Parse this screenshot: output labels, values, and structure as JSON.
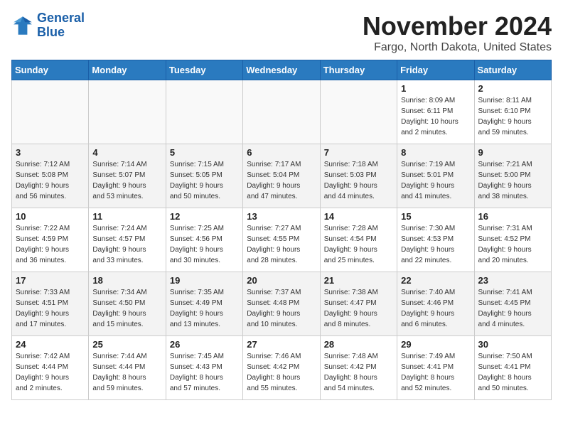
{
  "header": {
    "logo_line1": "General",
    "logo_line2": "Blue",
    "month_title": "November 2024",
    "location": "Fargo, North Dakota, United States"
  },
  "weekdays": [
    "Sunday",
    "Monday",
    "Tuesday",
    "Wednesday",
    "Thursday",
    "Friday",
    "Saturday"
  ],
  "weeks": [
    [
      {
        "day": "",
        "info": ""
      },
      {
        "day": "",
        "info": ""
      },
      {
        "day": "",
        "info": ""
      },
      {
        "day": "",
        "info": ""
      },
      {
        "day": "",
        "info": ""
      },
      {
        "day": "1",
        "info": "Sunrise: 8:09 AM\nSunset: 6:11 PM\nDaylight: 10 hours\nand 2 minutes."
      },
      {
        "day": "2",
        "info": "Sunrise: 8:11 AM\nSunset: 6:10 PM\nDaylight: 9 hours\nand 59 minutes."
      }
    ],
    [
      {
        "day": "3",
        "info": "Sunrise: 7:12 AM\nSunset: 5:08 PM\nDaylight: 9 hours\nand 56 minutes."
      },
      {
        "day": "4",
        "info": "Sunrise: 7:14 AM\nSunset: 5:07 PM\nDaylight: 9 hours\nand 53 minutes."
      },
      {
        "day": "5",
        "info": "Sunrise: 7:15 AM\nSunset: 5:05 PM\nDaylight: 9 hours\nand 50 minutes."
      },
      {
        "day": "6",
        "info": "Sunrise: 7:17 AM\nSunset: 5:04 PM\nDaylight: 9 hours\nand 47 minutes."
      },
      {
        "day": "7",
        "info": "Sunrise: 7:18 AM\nSunset: 5:03 PM\nDaylight: 9 hours\nand 44 minutes."
      },
      {
        "day": "8",
        "info": "Sunrise: 7:19 AM\nSunset: 5:01 PM\nDaylight: 9 hours\nand 41 minutes."
      },
      {
        "day": "9",
        "info": "Sunrise: 7:21 AM\nSunset: 5:00 PM\nDaylight: 9 hours\nand 38 minutes."
      }
    ],
    [
      {
        "day": "10",
        "info": "Sunrise: 7:22 AM\nSunset: 4:59 PM\nDaylight: 9 hours\nand 36 minutes."
      },
      {
        "day": "11",
        "info": "Sunrise: 7:24 AM\nSunset: 4:57 PM\nDaylight: 9 hours\nand 33 minutes."
      },
      {
        "day": "12",
        "info": "Sunrise: 7:25 AM\nSunset: 4:56 PM\nDaylight: 9 hours\nand 30 minutes."
      },
      {
        "day": "13",
        "info": "Sunrise: 7:27 AM\nSunset: 4:55 PM\nDaylight: 9 hours\nand 28 minutes."
      },
      {
        "day": "14",
        "info": "Sunrise: 7:28 AM\nSunset: 4:54 PM\nDaylight: 9 hours\nand 25 minutes."
      },
      {
        "day": "15",
        "info": "Sunrise: 7:30 AM\nSunset: 4:53 PM\nDaylight: 9 hours\nand 22 minutes."
      },
      {
        "day": "16",
        "info": "Sunrise: 7:31 AM\nSunset: 4:52 PM\nDaylight: 9 hours\nand 20 minutes."
      }
    ],
    [
      {
        "day": "17",
        "info": "Sunrise: 7:33 AM\nSunset: 4:51 PM\nDaylight: 9 hours\nand 17 minutes."
      },
      {
        "day": "18",
        "info": "Sunrise: 7:34 AM\nSunset: 4:50 PM\nDaylight: 9 hours\nand 15 minutes."
      },
      {
        "day": "19",
        "info": "Sunrise: 7:35 AM\nSunset: 4:49 PM\nDaylight: 9 hours\nand 13 minutes."
      },
      {
        "day": "20",
        "info": "Sunrise: 7:37 AM\nSunset: 4:48 PM\nDaylight: 9 hours\nand 10 minutes."
      },
      {
        "day": "21",
        "info": "Sunrise: 7:38 AM\nSunset: 4:47 PM\nDaylight: 9 hours\nand 8 minutes."
      },
      {
        "day": "22",
        "info": "Sunrise: 7:40 AM\nSunset: 4:46 PM\nDaylight: 9 hours\nand 6 minutes."
      },
      {
        "day": "23",
        "info": "Sunrise: 7:41 AM\nSunset: 4:45 PM\nDaylight: 9 hours\nand 4 minutes."
      }
    ],
    [
      {
        "day": "24",
        "info": "Sunrise: 7:42 AM\nSunset: 4:44 PM\nDaylight: 9 hours\nand 2 minutes."
      },
      {
        "day": "25",
        "info": "Sunrise: 7:44 AM\nSunset: 4:44 PM\nDaylight: 8 hours\nand 59 minutes."
      },
      {
        "day": "26",
        "info": "Sunrise: 7:45 AM\nSunset: 4:43 PM\nDaylight: 8 hours\nand 57 minutes."
      },
      {
        "day": "27",
        "info": "Sunrise: 7:46 AM\nSunset: 4:42 PM\nDaylight: 8 hours\nand 55 minutes."
      },
      {
        "day": "28",
        "info": "Sunrise: 7:48 AM\nSunset: 4:42 PM\nDaylight: 8 hours\nand 54 minutes."
      },
      {
        "day": "29",
        "info": "Sunrise: 7:49 AM\nSunset: 4:41 PM\nDaylight: 8 hours\nand 52 minutes."
      },
      {
        "day": "30",
        "info": "Sunrise: 7:50 AM\nSunset: 4:41 PM\nDaylight: 8 hours\nand 50 minutes."
      }
    ]
  ]
}
